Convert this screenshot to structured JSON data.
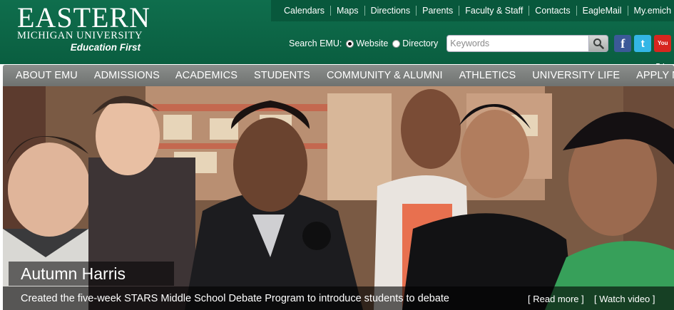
{
  "logo": {
    "name": "EASTERN",
    "subtitle": "MICHIGAN UNIVERSITY",
    "tagline": "Education First"
  },
  "top_links": [
    "Calendars",
    "Maps",
    "Directions",
    "Parents",
    "Faculty & Staff",
    "Contacts",
    "EagleMail",
    "My.emich"
  ],
  "search": {
    "label": "Search EMU:",
    "option_website": "Website",
    "option_directory": "Directory",
    "selected": "Website",
    "placeholder": "Keywords",
    "value": ""
  },
  "social": {
    "facebook_icon": "facebook-icon",
    "twitter_icon": "twitter-icon",
    "youtube_top": "You",
    "youtube_bottom": "Tube"
  },
  "nav": [
    "ABOUT EMU",
    "ADMISSIONS",
    "ACADEMICS",
    "STUDENTS",
    "COMMUNITY & ALUMNI",
    "ATHLETICS",
    "UNIVERSITY LIFE",
    "APPLY NOW"
  ],
  "hero": {
    "name": "Autumn Harris",
    "description": "Created the five-week STARS Middle School Debate Program to introduce students to debate",
    "read_more": "[ Read more ]",
    "watch_video": "[ Watch video ]"
  },
  "colors": {
    "brand_green": "#0a5e40",
    "nav_gray": "#7b7e7c"
  }
}
